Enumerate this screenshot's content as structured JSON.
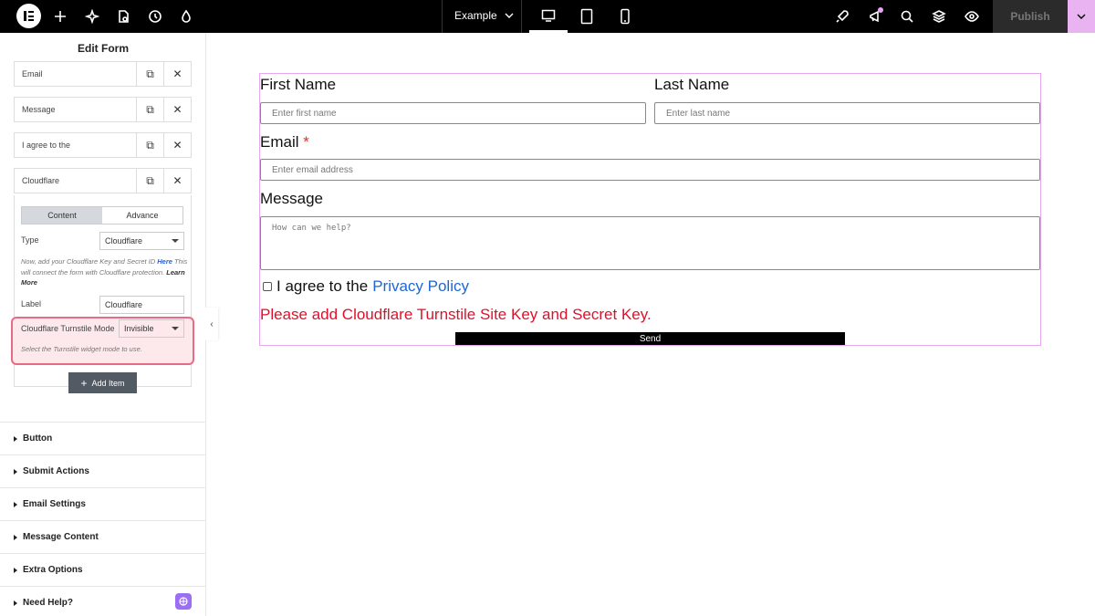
{
  "topbar": {
    "site_name": "Example",
    "publish_label": "Publish"
  },
  "sidebar": {
    "title": "Edit Form",
    "fields": [
      {
        "label": "Email"
      },
      {
        "label": "Message"
      },
      {
        "label": "I agree to the"
      },
      {
        "label": "Cloudflare"
      }
    ],
    "tabs": [
      "Content",
      "Advance"
    ],
    "type_label": "Type",
    "type_value": "Cloudflare",
    "help_text": "Now, add your Cloudflare Key and Secret ID",
    "help_link": "Here",
    "help_text2": "This will connect the form with Cloudflare protection.",
    "help_learn": "Learn More",
    "label_label": "Label",
    "label_value": "Cloudflare",
    "mode_label": "Cloudflare Turnstile Mode",
    "mode_value": "Invisible",
    "mode_help": "Select the Turnstile widget mode to use.",
    "add_item": "Add Item",
    "sections": [
      "Button",
      "Submit Actions",
      "Email Settings",
      "Message Content",
      "Extra Options",
      "Need Help?"
    ]
  },
  "form": {
    "first_name_label": "First Name",
    "first_name_placeholder": "Enter first name",
    "last_name_label": "Last Name",
    "last_name_placeholder": "Enter last name",
    "email_label": "Email",
    "email_required": "*",
    "email_placeholder": "Enter email address",
    "message_label": "Message",
    "message_placeholder": "How can we help?",
    "agree_text": "I agree to the",
    "agree_link": "Privacy Policy",
    "error": "Please add Cloudflare Turnstile Site Key and Secret Key.",
    "send": "Send"
  }
}
